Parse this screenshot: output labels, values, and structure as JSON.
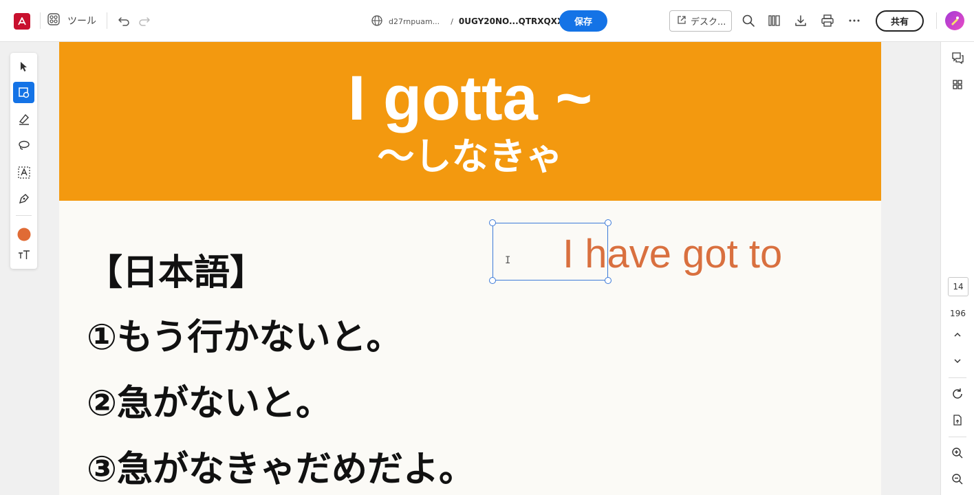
{
  "toolbar": {
    "tools_label": "ツール",
    "doc_domain": "d27rnpuam...",
    "path_separator": "/",
    "doc_name": "0UGY20NO...QTRXQXX",
    "save_label": "保存",
    "desktop_label": "デスク...",
    "share_label": "共有"
  },
  "document": {
    "banner_color": "#f3990f",
    "title": "I gotta ~",
    "subtitle": "～しなきゃ",
    "jp_heading": "【日本語】",
    "jp_lines": [
      "①もう行かないと。",
      "②急がないと。",
      "③急がなきゃだめだよ。"
    ],
    "en_text": "I have got to",
    "en_text_color": "#d9703f"
  },
  "right_panel": {
    "current_page": "14",
    "total_pages": "196"
  },
  "colors": {
    "accent": "#1473e6",
    "active_color_swatch": "#e06b35"
  },
  "icons": {
    "left_tools": [
      "select-arrow-icon",
      "select-region-icon",
      "highlighter-icon",
      "lasso-icon",
      "text-box-icon",
      "pen-icon",
      "color-swatch-icon",
      "text-size-icon"
    ],
    "right_tools": [
      "comment-icon",
      "grid-icon",
      "chevron-up-icon",
      "chevron-down-icon",
      "rotate-icon",
      "page-export-icon",
      "zoom-in-icon",
      "zoom-out-icon"
    ]
  }
}
